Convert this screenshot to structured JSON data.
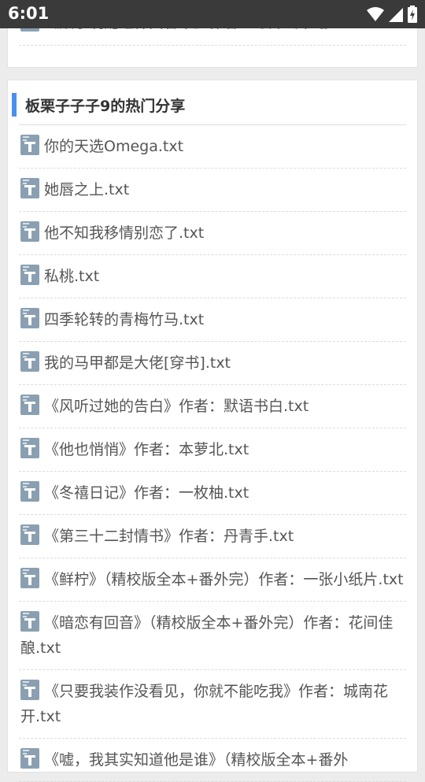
{
  "status_bar": {
    "time": "6:01"
  },
  "previous_card": {
    "partial_item": "《赎予说配这样面容帮》作者：寻开云半路.txt"
  },
  "section": {
    "title": "板栗子子子9的热门分享",
    "items": [
      "你的天选Omega.txt",
      "她唇之上.txt",
      "他不知我移情别恋了.txt",
      "私桃.txt",
      "四季轮转的青梅竹马.txt",
      "我的马甲都是大佬[穿书].txt",
      "《风听过她的告白》作者：默语书白.txt",
      "《他也悄悄》作者：本萝北.txt",
      "《冬禧日记》作者：一枚柚.txt",
      "《第三十二封情书》作者：丹青手.txt",
      "《鲜柠》（精校版全本+番外完）作者：一张小纸片.txt",
      "《暗恋有回音》（精校版全本+番外完）作者：花间佳酿.txt",
      "《只要我装作没看见，你就不能吃我》作者：城南花开.txt",
      "《嘘，我其实知道他是谁》（精校版全本+番外"
    ]
  },
  "colors": {
    "accent": "#4a8fe8",
    "status_bar": "#3a3a3a",
    "file_icon": "#8aa0b2"
  }
}
